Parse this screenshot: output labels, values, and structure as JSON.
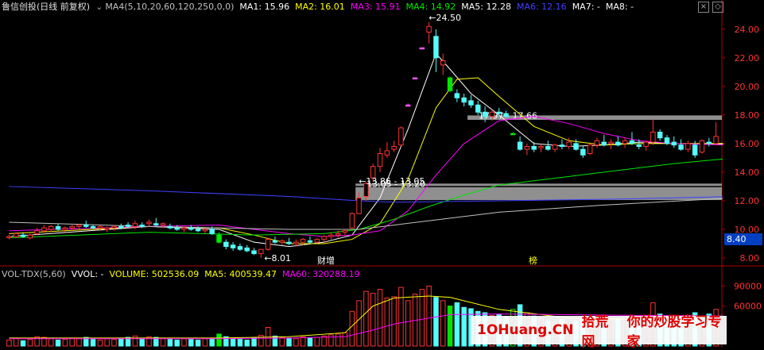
{
  "header": {
    "stock": "鲁信创投(日线 前复权)",
    "indicator": "MA4(5,10,20,60,120,250,0,0)",
    "ma1": "MA1: 15.96",
    "ma2": "MA2: 16.01",
    "ma3": "MA3: 15.91",
    "ma4": "MA4: 14.92",
    "ma5": "MA5: 12.28",
    "ma6": "MA6: 12.16",
    "ma7": "MA7: -",
    "ma8": "MA8: -"
  },
  "vol_header": {
    "indicator": "VOL-TDX(5,60)",
    "vvol": "VVOL: -",
    "volume": "VOLUME: 502536.09",
    "ma5": "MA5: 400539.47",
    "ma60": "MA60: 320288.19"
  },
  "markers": {
    "earnings": "财",
    "increase": "增",
    "list": "榜"
  },
  "price_tag": "8.40",
  "watermark": {
    "site": "1OHuang.CN",
    "name": "拾荒网",
    "slogan": "你的炒股学习专家"
  },
  "colors": {
    "up": "#ff3232",
    "down": "#54fcfc",
    "limit": "#ff54ff",
    "drop": "#00e600",
    "ma1": "#ffffff",
    "ma2": "#ffff00",
    "ma3": "#ff00ff",
    "ma4": "#00e600",
    "ma5": "#4040ff",
    "ma6": "#c0c0c0",
    "axis": "#b00000",
    "label": "#ff3232"
  },
  "chart_data": [
    {
      "type": "candlestick",
      "title": "鲁信创投(日线 前复权)",
      "y_ticks": [
        8.0,
        10.0,
        12.0,
        14.0,
        16.0,
        18.0,
        20.0,
        22.0,
        24.0
      ],
      "ylim": [
        7.5,
        25.1
      ],
      "ohlc": [
        [
          9.5,
          9.6,
          9.3,
          9.5
        ],
        [
          9.5,
          9.8,
          9.4,
          9.7
        ],
        [
          9.6,
          9.8,
          9.4,
          9.5
        ],
        [
          9.4,
          9.7,
          9.3,
          9.6
        ],
        [
          9.7,
          10.1,
          9.6,
          9.9
        ],
        [
          9.9,
          10.3,
          9.8,
          10.1
        ],
        [
          10.0,
          10.3,
          9.8,
          10.2
        ],
        [
          10.2,
          10.4,
          9.9,
          10.0
        ],
        [
          10.0,
          10.2,
          9.8,
          10.1
        ],
        [
          10.1,
          10.3,
          9.9,
          10.2
        ],
        [
          10.2,
          10.4,
          10.0,
          10.3
        ],
        [
          10.3,
          10.6,
          10.1,
          10.2
        ],
        [
          10.2,
          10.3,
          10.0,
          10.1
        ],
        [
          10.1,
          10.3,
          9.9,
          10.2
        ],
        [
          10.0,
          10.2,
          9.8,
          10.1
        ],
        [
          10.1,
          10.3,
          9.9,
          10.2
        ],
        [
          10.2,
          10.4,
          10.0,
          10.1
        ],
        [
          10.3,
          10.5,
          10.1,
          10.2
        ],
        [
          10.2,
          10.6,
          10.0,
          10.4
        ],
        [
          10.3,
          10.5,
          10.1,
          10.2
        ],
        [
          10.4,
          10.7,
          10.2,
          10.5
        ],
        [
          10.4,
          10.8,
          10.2,
          10.3
        ],
        [
          10.3,
          10.5,
          10.1,
          10.4
        ],
        [
          10.2,
          10.4,
          10.0,
          10.1
        ],
        [
          10.1,
          10.3,
          9.9,
          10.0
        ],
        [
          10.0,
          10.2,
          9.8,
          10.1
        ],
        [
          10.1,
          10.3,
          9.9,
          10.0
        ],
        [
          10.0,
          10.2,
          9.8,
          9.9
        ],
        [
          9.9,
          10.1,
          9.7,
          10.0
        ],
        [
          10.0,
          10.2,
          9.6,
          9.7
        ],
        [
          9.6,
          9.8,
          9.0,
          9.1
        ],
        [
          9.1,
          9.3,
          8.6,
          8.8
        ],
        [
          8.9,
          9.1,
          8.5,
          8.7
        ],
        [
          8.8,
          9.0,
          8.5,
          8.6
        ],
        [
          8.7,
          8.9,
          8.4,
          8.5
        ],
        [
          8.5,
          8.7,
          8.2,
          8.3
        ],
        [
          8.3,
          8.5,
          8.01,
          8.6
        ],
        [
          8.6,
          9.4,
          8.5,
          9.3
        ],
        [
          9.2,
          9.5,
          9.0,
          9.1
        ],
        [
          9.1,
          9.3,
          8.9,
          9.2
        ],
        [
          9.1,
          9.4,
          8.9,
          9.0
        ],
        [
          9.0,
          9.3,
          8.8,
          9.1
        ],
        [
          9.1,
          9.4,
          8.9,
          9.3
        ],
        [
          9.2,
          9.5,
          9.0,
          9.1
        ],
        [
          9.1,
          9.4,
          9.0,
          9.3
        ],
        [
          9.3,
          9.6,
          9.1,
          9.5
        ],
        [
          9.5,
          9.8,
          9.3,
          9.6
        ],
        [
          9.6,
          9.9,
          9.4,
          9.7
        ],
        [
          9.8,
          10.0,
          9.6,
          9.9
        ],
        [
          10.1,
          11.2,
          10.1,
          11.1
        ],
        [
          11.1,
          12.6,
          11.1,
          12.2
        ],
        [
          12.3,
          13.3,
          12.0,
          13.2
        ],
        [
          13.6,
          14.6,
          13.4,
          14.4
        ],
        [
          14.4,
          15.7,
          14.0,
          15.3
        ],
        [
          15.2,
          16.1,
          15.0,
          15.5
        ],
        [
          15.6,
          16.2,
          15.4,
          15.8
        ],
        [
          15.9,
          17.2,
          15.8,
          17.1
        ],
        [
          18.7,
          18.8,
          18.6,
          18.7
        ],
        [
          20.6,
          20.6,
          20.6,
          20.6
        ],
        [
          22.7,
          22.7,
          22.7,
          22.7
        ],
        [
          23.8,
          24.5,
          23.0,
          24.2
        ],
        [
          23.5,
          24.0,
          21.0,
          22.0
        ],
        [
          21.5,
          22.3,
          20.8,
          21.8
        ],
        [
          20.6,
          20.7,
          19.6,
          19.7
        ],
        [
          19.5,
          19.8,
          18.9,
          19.2
        ],
        [
          19.2,
          19.5,
          18.6,
          18.9
        ],
        [
          19.0,
          19.4,
          18.5,
          18.7
        ],
        [
          18.7,
          19.0,
          18.0,
          18.2
        ],
        [
          18.2,
          18.6,
          17.5,
          17.9
        ],
        [
          17.9,
          18.3,
          17.6,
          18.2
        ],
        [
          18.2,
          18.5,
          17.9,
          18.1
        ],
        [
          18.1,
          18.3,
          17.8,
          17.9
        ],
        [
          16.7,
          16.8,
          16.6,
          16.7
        ],
        [
          16.1,
          16.5,
          15.5,
          15.6
        ],
        [
          15.6,
          16.0,
          15.2,
          15.8
        ],
        [
          15.8,
          16.1,
          15.4,
          15.6
        ],
        [
          15.7,
          16.0,
          15.4,
          15.8
        ],
        [
          15.8,
          16.2,
          15.5,
          15.6
        ],
        [
          15.6,
          16.0,
          15.4,
          15.9
        ],
        [
          15.9,
          16.3,
          15.6,
          15.8
        ],
        [
          15.8,
          16.4,
          15.6,
          16.1
        ],
        [
          16.0,
          16.3,
          15.5,
          15.6
        ],
        [
          15.6,
          15.8,
          15.0,
          15.2
        ],
        [
          15.3,
          16.0,
          15.2,
          15.9
        ],
        [
          15.9,
          16.4,
          15.7,
          16.2
        ],
        [
          16.1,
          16.6,
          15.8,
          15.9
        ],
        [
          16.0,
          16.3,
          15.6,
          16.1
        ],
        [
          16.1,
          16.5,
          15.8,
          15.9
        ],
        [
          16.0,
          16.4,
          15.7,
          16.2
        ],
        [
          16.2,
          16.8,
          15.9,
          16.0
        ],
        [
          15.9,
          16.3,
          15.6,
          15.8
        ],
        [
          15.8,
          16.2,
          15.5,
          16.1
        ],
        [
          16.1,
          17.7,
          15.9,
          16.8
        ],
        [
          16.8,
          17.0,
          16.2,
          16.4
        ],
        [
          16.4,
          16.6,
          15.9,
          16.0
        ],
        [
          16.1,
          16.5,
          15.7,
          15.9
        ],
        [
          15.9,
          16.3,
          15.5,
          15.6
        ],
        [
          15.6,
          16.2,
          15.4,
          16.0
        ],
        [
          15.9,
          16.2,
          15.0,
          15.2
        ],
        [
          15.4,
          16.3,
          15.3,
          16.2
        ],
        [
          16.1,
          16.4,
          15.8,
          16.0
        ],
        [
          16.0,
          17.5,
          15.9,
          16.5
        ]
      ],
      "limit_candles": [
        57,
        58,
        59
      ],
      "drop_candles": [
        30,
        63,
        72
      ],
      "ma_lines": [
        {
          "id": "ma1",
          "x": [
            0,
            20,
            30,
            35,
            40,
            45,
            49,
            53,
            57,
            61,
            63,
            66,
            70,
            75,
            80,
            85,
            90,
            95,
            102
          ],
          "y": [
            9.5,
            10.2,
            10.0,
            9.1,
            8.8,
            9.1,
            9.6,
            12.2,
            17.0,
            22.3,
            21.2,
            19.5,
            18.0,
            16.0,
            15.8,
            15.9,
            16.1,
            16.0,
            15.96
          ]
        },
        {
          "id": "ma2",
          "x": [
            0,
            20,
            30,
            35,
            40,
            45,
            49,
            53,
            57,
            61,
            64,
            67,
            70,
            75,
            80,
            85,
            90,
            95,
            102
          ],
          "y": [
            9.7,
            10.2,
            10.1,
            9.6,
            9.0,
            9.0,
            9.3,
            10.4,
            13.5,
            18.5,
            20.5,
            20.6,
            19.3,
            17.2,
            16.2,
            15.9,
            16.0,
            16.0,
            16.01
          ]
        },
        {
          "id": "ma3",
          "x": [
            0,
            20,
            30,
            35,
            40,
            45,
            49,
            53,
            57,
            61,
            65,
            70,
            75,
            80,
            85,
            90,
            95,
            102
          ],
          "y": [
            9.9,
            10.2,
            10.3,
            10.0,
            9.7,
            9.5,
            9.6,
            9.9,
            11.3,
            13.8,
            16.0,
            17.6,
            17.9,
            17.4,
            16.7,
            16.2,
            16.0,
            15.91
          ]
        },
        {
          "id": "ma4",
          "x": [
            0,
            20,
            35,
            45,
            50,
            55,
            60,
            65,
            70,
            75,
            80,
            85,
            90,
            95,
            102
          ],
          "y": [
            9.4,
            9.8,
            9.6,
            9.7,
            10.0,
            10.7,
            11.6,
            12.4,
            13.1,
            13.4,
            13.7,
            14.0,
            14.3,
            14.6,
            14.92
          ]
        },
        {
          "id": "ma5",
          "x": [
            0,
            20,
            40,
            50,
            55,
            70,
            85,
            102
          ],
          "y": [
            13.0,
            12.7,
            12.3,
            12.0,
            11.9,
            12.0,
            12.1,
            12.28
          ]
        },
        {
          "id": "ma6",
          "x": [
            0,
            20,
            40,
            50,
            55,
            70,
            85,
            102
          ],
          "y": [
            10.5,
            10.2,
            10.0,
            10.0,
            10.3,
            11.2,
            11.7,
            12.16
          ]
        }
      ],
      "zones": [
        {
          "from": 66,
          "to": 102,
          "low": 17.66,
          "high": 17.97,
          "label": "17.97 - 17.66"
        },
        {
          "from": 50,
          "to": 102,
          "low": 13.05,
          "high": 13.2,
          "label": "13.05 - 13.20"
        },
        {
          "from": 50,
          "to": 102,
          "low": 12.05,
          "high": 12.95,
          "label": ""
        }
      ],
      "annotations": [
        {
          "x": 59.5,
          "y": 24.5,
          "label": "24.50"
        },
        {
          "x": 36,
          "y": 8.01,
          "label": "8.01"
        },
        {
          "x": 49.5,
          "y": 13.05,
          "label": "13.86 - 13.05"
        }
      ]
    },
    {
      "type": "bar",
      "title": "VOL-TDX(5,60)",
      "y_ticks": [
        60000,
        90000
      ],
      "ylim": [
        0,
        100000
      ],
      "volume": [
        9000,
        12000,
        8000,
        10000,
        14000,
        13000,
        11000,
        9000,
        10000,
        12000,
        11000,
        13000,
        10000,
        9000,
        11000,
        10000,
        12000,
        13000,
        15000,
        11000,
        14000,
        13000,
        12000,
        10000,
        9000,
        11000,
        10000,
        9000,
        11000,
        12000,
        18000,
        14000,
        11000,
        10000,
        9000,
        12000,
        16000,
        28000,
        15000,
        13000,
        12000,
        11000,
        14000,
        12000,
        13000,
        15000,
        17000,
        18000,
        20000,
        52000,
        68000,
        82000,
        79000,
        85000,
        72000,
        74000,
        88000,
        68000,
        78000,
        85000,
        90000,
        73000,
        68000,
        60000,
        65000,
        58000,
        56000,
        52000,
        50000,
        46000,
        48000,
        44000,
        55000,
        62000,
        50000,
        45000,
        42000,
        38000,
        36000,
        40000,
        42000,
        38000,
        44000,
        40000,
        38000,
        42000,
        39000,
        41000,
        44000,
        40000,
        38000,
        42000,
        65000,
        48000,
        44000,
        41000,
        43000,
        46000,
        50000,
        44000,
        48000,
        55000
      ],
      "ma5": {
        "x": [
          0,
          30,
          40,
          48,
          52,
          55,
          60,
          63,
          70,
          80,
          90,
          102
        ],
        "y": [
          12000,
          12000,
          14000,
          20000,
          60000,
          72000,
          75000,
          73000,
          55000,
          42000,
          40000,
          45000
        ]
      },
      "ma60": {
        "x": [
          0,
          30,
          40,
          48,
          52,
          55,
          60,
          63,
          70,
          80,
          90,
          102
        ],
        "y": [
          11000,
          11000,
          12000,
          14000,
          24000,
          33000,
          42000,
          47000,
          48000,
          47000,
          46000,
          45000
        ]
      }
    }
  ]
}
